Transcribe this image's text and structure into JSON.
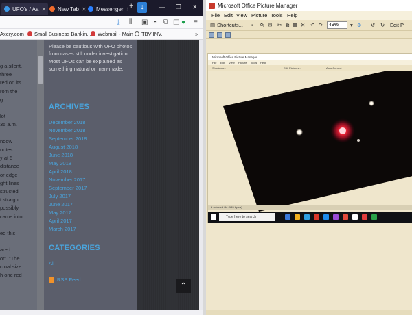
{
  "firefox": {
    "tabs": [
      {
        "label": "UFO's / Aa",
        "color": "#3d9be9"
      },
      {
        "label": "New Tab",
        "color": "#f06a2b"
      },
      {
        "label": "Messenger",
        "color": "#2a7fff"
      }
    ],
    "new_tab_symbol": "+",
    "window_controls": {
      "minimize": "—",
      "restore": "❐",
      "close": "✕"
    },
    "download_icon": "download-arrow",
    "bookmarks": [
      {
        "label": "Axery.com",
        "color": "#777777"
      },
      {
        "label": "Small Business Bankin...",
        "color": "#d23a3a"
      },
      {
        "label": "Webmail - Main",
        "color": "#d23a3a"
      },
      {
        "label": "TBV INV.",
        "color": "#555555"
      }
    ],
    "overflow_symbol": "»",
    "left_column_lines": [
      "g a silent,",
      "three",
      "red on its",
      "rom the",
      "g",
      "",
      "lot",
      "35 a.m.",
      "",
      "ndow",
      "nutes",
      "y at 5",
      "distance",
      "or edge",
      "ght lines",
      "structed",
      "t straight",
      "possibly",
      "came into",
      "",
      "ed this",
      "",
      "ared",
      "ort. \"The",
      "ctual size",
      "h one red"
    ],
    "intro_text": "Please be cautious with UFO photos from cases still under investigation. Most UFOs can be explained as something natural or man-made.",
    "archives_heading": "ARCHIVES",
    "archives": [
      "December 2018",
      "November 2018",
      "September 2018",
      "August 2018",
      "June 2018",
      "May 2018",
      "April 2018",
      "November 2017",
      "September 2017",
      "July 2017",
      "June 2017",
      "May 2017",
      "April 2017",
      "March 2017"
    ],
    "categories_heading": "CATEGORIES",
    "categories": [
      "All"
    ],
    "rss_label": "RSS Feed",
    "to_top_symbol": "⌃"
  },
  "picture_manager": {
    "title": "Microsoft Office Picture Manager",
    "menu": [
      "File",
      "Edit",
      "View",
      "Picture",
      "Tools",
      "Help"
    ],
    "toolbar": {
      "shortcuts_label": "Shortcuts...",
      "zoom_value": "49%",
      "edit_label": "Edit P"
    },
    "inner_screenshot": {
      "title": "Microsoft Office Picture Manager",
      "menu": [
        "File",
        "Edit",
        "View",
        "Picture",
        "Tools",
        "Help"
      ],
      "toolbar_items": [
        "Shortcuts...",
        "Edit Pictures...",
        "Auto Correct"
      ],
      "status_text": "1 selected file (163 bytes)",
      "taskbar_search": "Type here to search",
      "taskbar_app_colors": [
        "#3b78d8",
        "#f2b01e",
        "#2f9fe0",
        "#d9372a",
        "#1f8ceb",
        "#9b4bd6",
        "#e24a3b",
        "#ffffff",
        "#e13d3d",
        "#2aa34a"
      ]
    },
    "photo": {
      "background_color": "#0c0807",
      "red_light_color": "#ff2a3c",
      "white_light_color": "#fff6e6"
    }
  }
}
